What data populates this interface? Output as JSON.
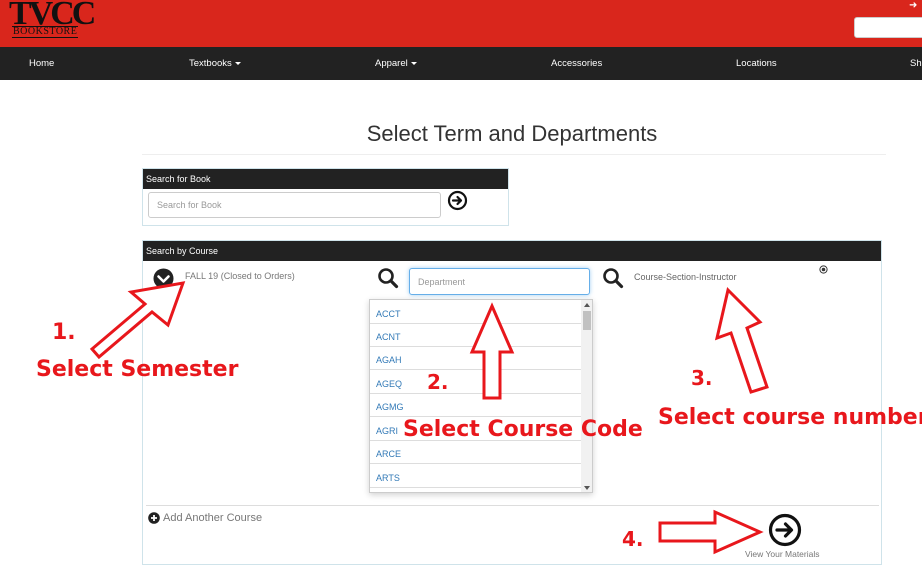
{
  "header": {
    "logo_main": "TVCC",
    "logo_sub": "BOOKSTORE"
  },
  "nav": {
    "items": [
      {
        "label": "Home"
      },
      {
        "label": "Textbooks"
      },
      {
        "label": "Apparel"
      },
      {
        "label": "Accessories"
      },
      {
        "label": "Locations"
      },
      {
        "label": "Sh"
      }
    ]
  },
  "main": {
    "title": "Select Term and Departments",
    "book_search": {
      "header": "Search for Book",
      "placeholder": "Search for Book"
    },
    "course_search": {
      "header": "Search by Course",
      "term": "FALL 19 (Closed to Orders)",
      "department_placeholder": "Department",
      "course_placeholder": "Course-Section-Instructor",
      "add_course": "Add Another Course",
      "view_materials": "View Your Materials",
      "departments": [
        "ACCT",
        "ACNT",
        "AGAH",
        "AGEQ",
        "AGMG",
        "AGRI",
        "ARCE",
        "ARTS"
      ]
    }
  },
  "annotations": {
    "step1_number": "1.",
    "step1_text": "Select Semester",
    "step2_number": "2.",
    "step2_text": "Select Course Code",
    "step3_number": "3.",
    "step3_text": "Select course number",
    "step4_number": "4.",
    "color": "#e8171c"
  }
}
